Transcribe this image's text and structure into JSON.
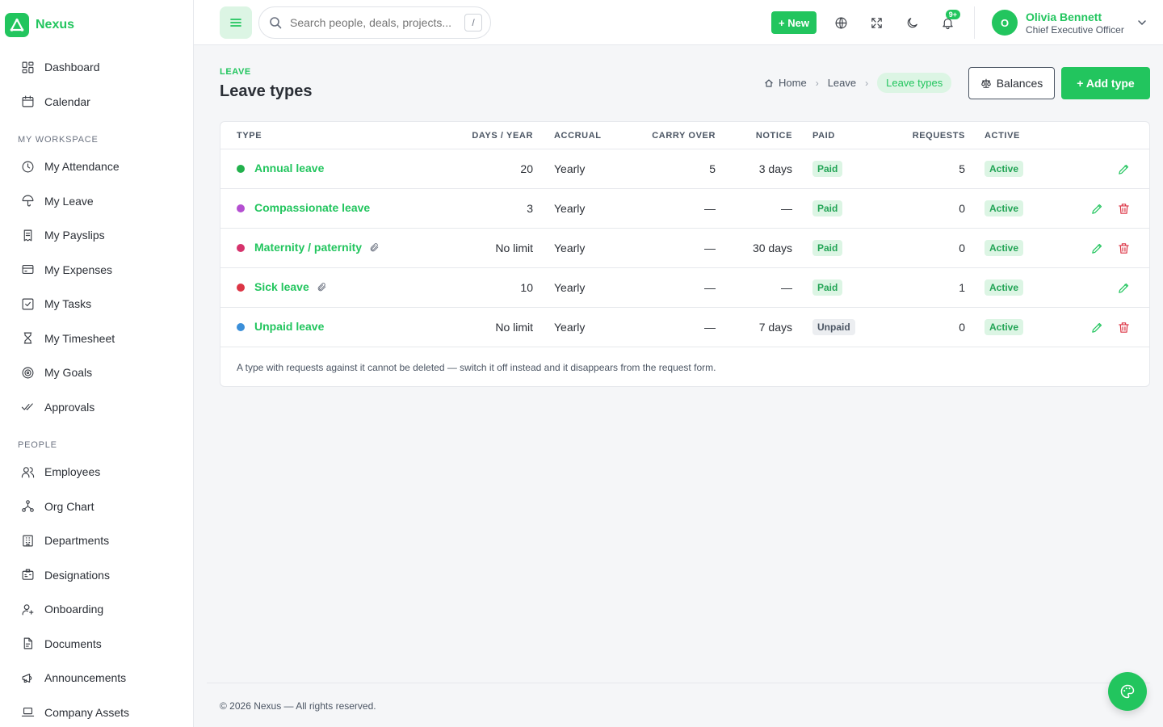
{
  "brand": {
    "name": "Nexus"
  },
  "sidebar": {
    "top_items": [
      {
        "label": "Dashboard",
        "icon": "dashboard-icon"
      },
      {
        "label": "Calendar",
        "icon": "calendar-icon"
      }
    ],
    "sections": [
      {
        "title": "MY WORKSPACE",
        "items": [
          {
            "label": "My Attendance",
            "icon": "clock-icon"
          },
          {
            "label": "My Leave",
            "icon": "umbrella-icon"
          },
          {
            "label": "My Payslips",
            "icon": "receipt-icon"
          },
          {
            "label": "My Expenses",
            "icon": "credit-card-icon"
          },
          {
            "label": "My Tasks",
            "icon": "checkbox-icon"
          },
          {
            "label": "My Timesheet",
            "icon": "hourglass-icon"
          },
          {
            "label": "My Goals",
            "icon": "target-icon"
          },
          {
            "label": "Approvals",
            "icon": "double-check-icon"
          }
        ]
      },
      {
        "title": "PEOPLE",
        "items": [
          {
            "label": "Employees",
            "icon": "users-icon"
          },
          {
            "label": "Org Chart",
            "icon": "org-chart-icon"
          },
          {
            "label": "Departments",
            "icon": "building-icon"
          },
          {
            "label": "Designations",
            "icon": "id-badge-icon"
          },
          {
            "label": "Onboarding",
            "icon": "user-plus-icon"
          },
          {
            "label": "Documents",
            "icon": "document-icon"
          },
          {
            "label": "Announcements",
            "icon": "megaphone-icon"
          },
          {
            "label": "Company Assets",
            "icon": "laptop-icon"
          }
        ]
      }
    ]
  },
  "topbar": {
    "search_placeholder": "Search people, deals, projects...",
    "search_shortcut": "/",
    "new_label": "+ New",
    "notifications_badge": "9+",
    "user": {
      "initial": "O",
      "name": "Olivia Bennett",
      "role": "Chief Executive Officer"
    }
  },
  "page": {
    "eyebrow": "LEAVE",
    "title": "Leave types",
    "breadcrumbs": [
      "Home",
      "Leave",
      "Leave types"
    ],
    "balances_label": "Balances",
    "add_label": "+ Add type"
  },
  "table": {
    "headers": [
      "TYPE",
      "DAYS / YEAR",
      "ACCRUAL",
      "CARRY OVER",
      "NOTICE",
      "PAID",
      "REQUESTS",
      "ACTIVE"
    ],
    "rows": [
      {
        "color": "#22b14c",
        "name": "Annual leave",
        "attach": false,
        "days": "20",
        "accrual": "Yearly",
        "carry": "5",
        "notice": "3 days",
        "paid": "Paid",
        "requests": "5",
        "active": "Active",
        "deletable": false
      },
      {
        "color": "#b44fd1",
        "name": "Compassionate leave",
        "attach": false,
        "days": "3",
        "accrual": "Yearly",
        "carry": "—",
        "notice": "—",
        "paid": "Paid",
        "requests": "0",
        "active": "Active",
        "deletable": true
      },
      {
        "color": "#d6336c",
        "name": "Maternity / paternity",
        "attach": true,
        "days": "No limit",
        "accrual": "Yearly",
        "carry": "—",
        "notice": "30 days",
        "paid": "Paid",
        "requests": "0",
        "active": "Active",
        "deletable": true
      },
      {
        "color": "#dc3545",
        "name": "Sick leave",
        "attach": true,
        "days": "10",
        "accrual": "Yearly",
        "carry": "—",
        "notice": "—",
        "paid": "Paid",
        "requests": "1",
        "active": "Active",
        "deletable": false
      },
      {
        "color": "#3b8fd9",
        "name": "Unpaid leave",
        "attach": false,
        "days": "No limit",
        "accrual": "Yearly",
        "carry": "—",
        "notice": "7 days",
        "paid": "Unpaid",
        "requests": "0",
        "active": "Active",
        "deletable": true
      }
    ],
    "footnote": "A type with requests against it cannot be deleted — switch it off instead and it disappears from the request form."
  },
  "footer": {
    "text": "© 2026 Nexus — All rights reserved."
  },
  "colors": {
    "accent": "#22c55e",
    "danger": "#dc3545"
  }
}
